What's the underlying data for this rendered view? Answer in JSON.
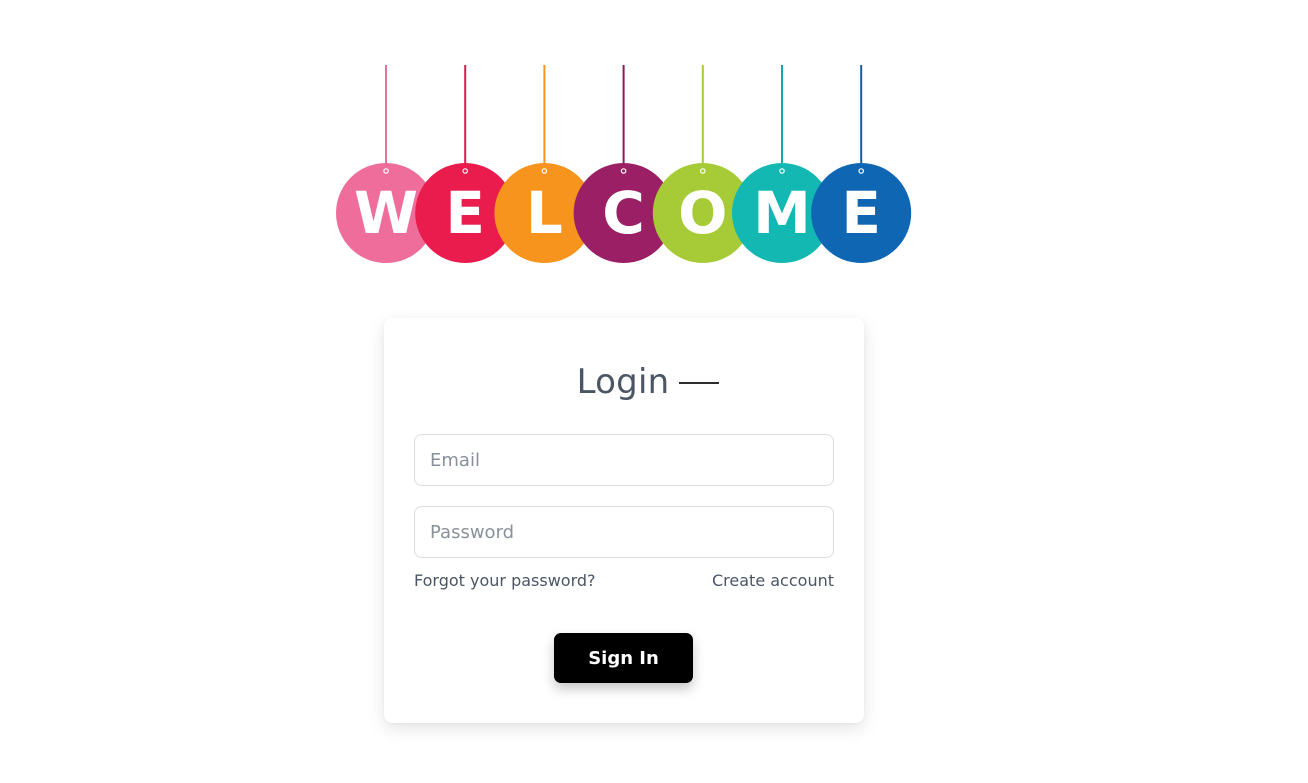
{
  "banner": {
    "letters": [
      {
        "char": "W",
        "color": "#ee6d9a",
        "string_color": "#ee6d9a"
      },
      {
        "char": "E",
        "color": "#e91c4d",
        "string_color": "#d81b50"
      },
      {
        "char": "L",
        "color": "#f7941e",
        "string_color": "#f7941e"
      },
      {
        "char": "C",
        "color": "#9b1f64",
        "string_color": "#8e1a5c"
      },
      {
        "char": "O",
        "color": "#a6cb37",
        "string_color": "#a6cb37"
      },
      {
        "char": "M",
        "color": "#13b8b2",
        "string_color": "#13a8a8"
      },
      {
        "char": "E",
        "color": "#0f66b3",
        "string_color": "#0f5fa8"
      }
    ]
  },
  "login": {
    "title": "Login",
    "email_placeholder": "Email",
    "email_value": "",
    "password_placeholder": "Password",
    "password_value": "",
    "forgot_label": "Forgot your password?",
    "create_label": "Create account",
    "signin_label": "Sign In"
  },
  "colors": {
    "accent": "#000000",
    "text": "#4b5563",
    "placeholder": "#8a909a",
    "border": "#dadde2"
  }
}
